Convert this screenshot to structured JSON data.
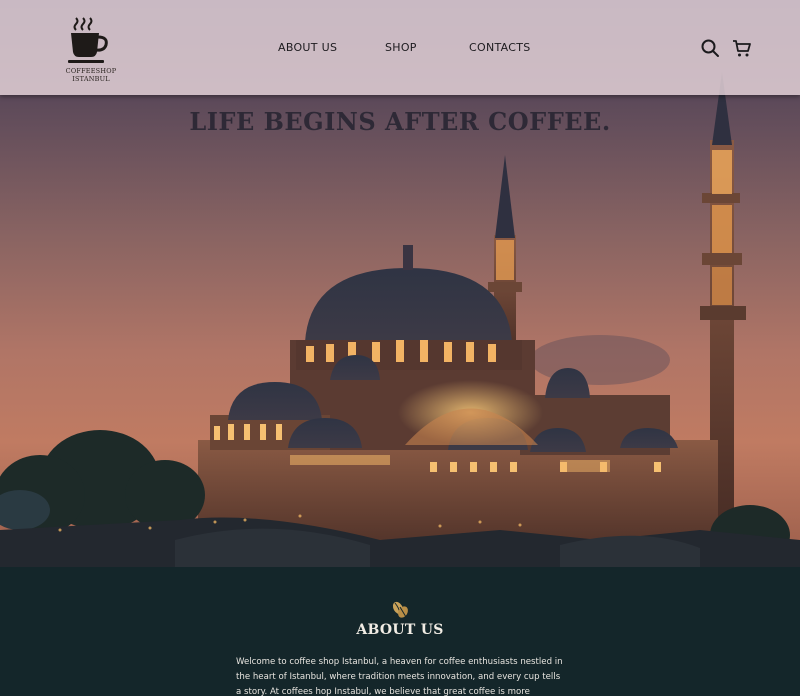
{
  "header": {
    "logo_text": "COFFEESHOP ISTANBUL",
    "nav": {
      "about": "ABOUT US",
      "shop": "SHOP",
      "contacts": "CONTACTS"
    },
    "icons": [
      "search-icon",
      "cart-icon"
    ]
  },
  "hero": {
    "headline": "LIFE BEGINS AFTER COFFEE."
  },
  "about": {
    "icon": "coffee-beans-icon",
    "title": "ABOUT US",
    "text": "Welcome to coffee shop Istanbul, a heaven for coffee enthusiasts nestled in the heart of Istanbul, where tradition meets innovation, and every cup tells a story. At coffees hop Instabul, we believe that great coffee is more"
  },
  "colors": {
    "navbar_bg": "#e8d6dc",
    "dark_section": "#14262a",
    "accent_gold": "#c9a25a",
    "headline": "#2e2936"
  }
}
